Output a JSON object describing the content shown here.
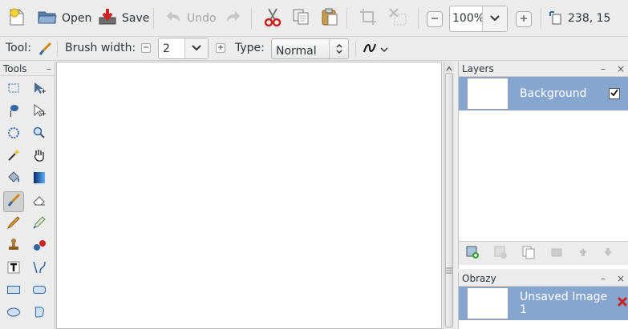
{
  "toolbar": {
    "new_icon": "new-image-icon",
    "open_label": "Open",
    "save_label": "Save",
    "undo_label": "Undo",
    "zoom_value": "100%",
    "cursor_position": "238, 15"
  },
  "options": {
    "tool_label": "Tool:",
    "brush_width_label": "Brush width:",
    "brush_width_value": "2",
    "type_label": "Type:",
    "type_value": "Normal"
  },
  "tools_panel": {
    "title": "Tools",
    "minimize": "–"
  },
  "layers_panel": {
    "title": "Layers",
    "minimize": "–",
    "close": "×",
    "layers": [
      {
        "name": "Background",
        "visible": true,
        "selected": true
      }
    ]
  },
  "images_panel": {
    "title": "Obrazy",
    "minimize": "–",
    "close": "×",
    "images": [
      {
        "name": "Unsaved Image 1",
        "selected": true
      }
    ]
  },
  "colors": {
    "selection": "#86a6cf",
    "accent_red": "#cc2222"
  }
}
